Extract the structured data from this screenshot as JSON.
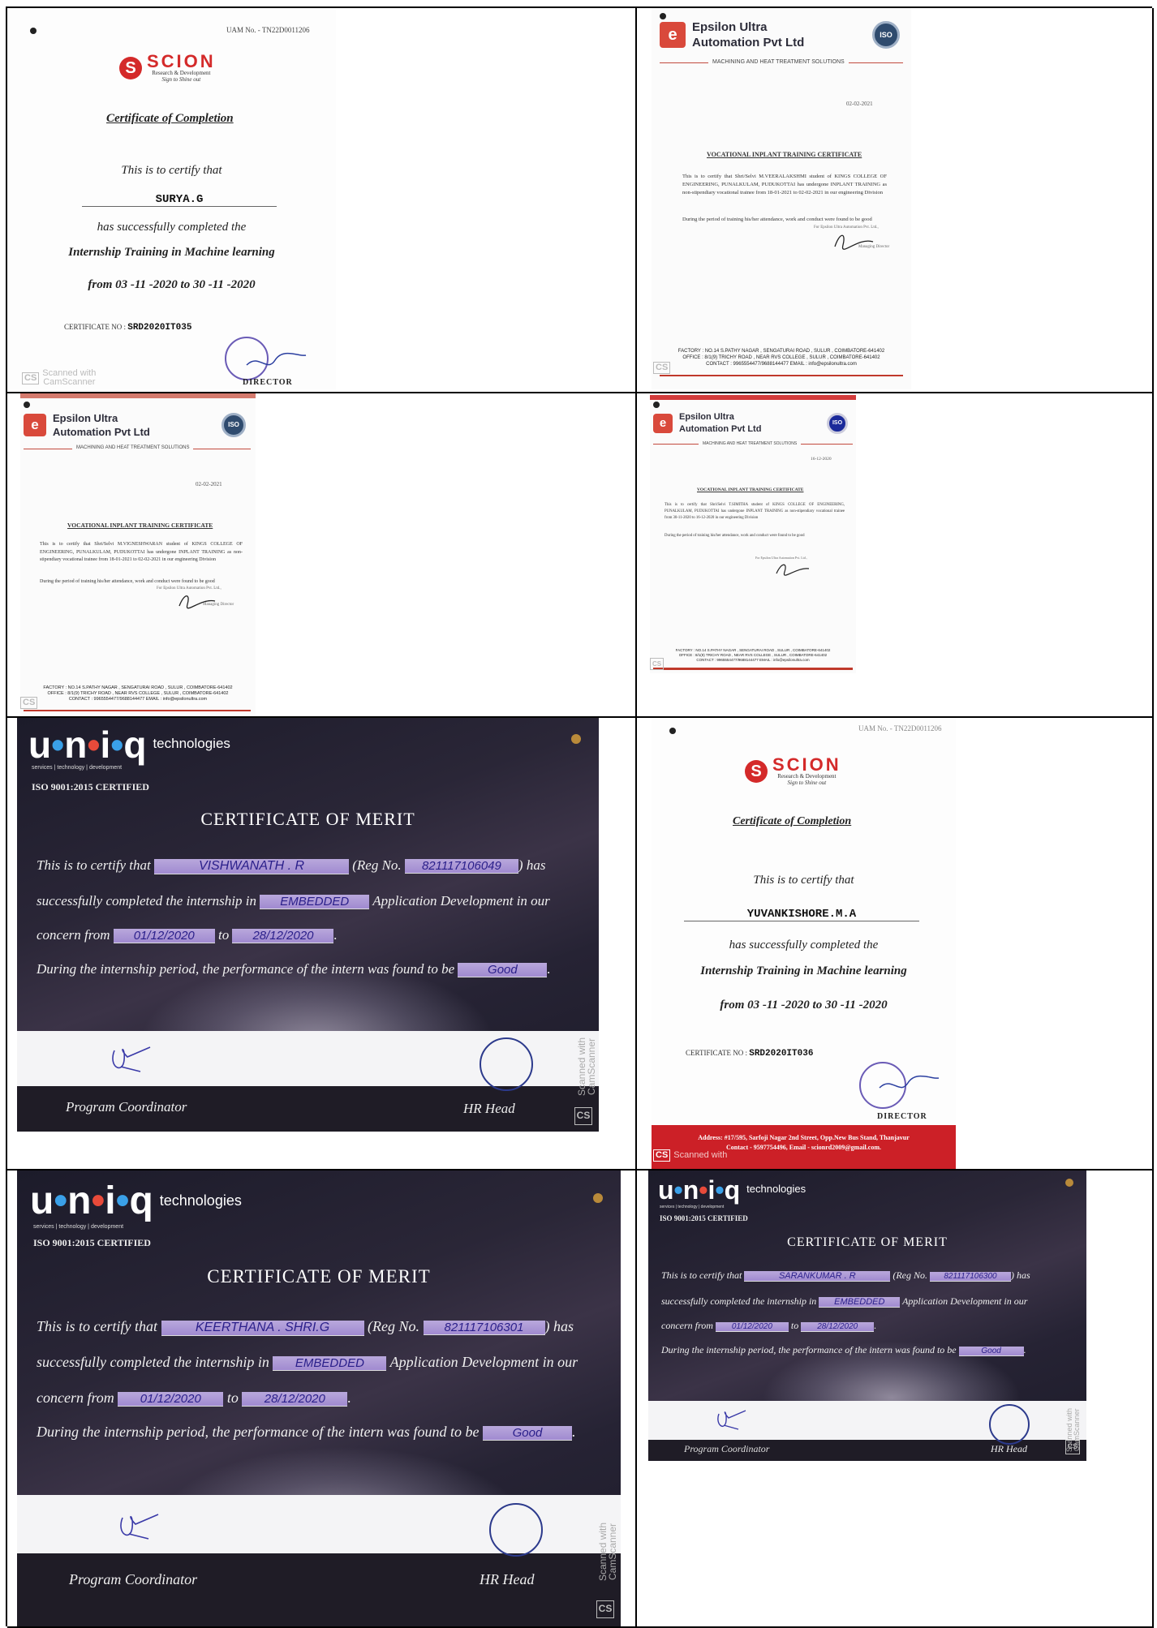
{
  "scanner": {
    "cs": "CS",
    "text1": "Scanned with",
    "text2": "CamScanner"
  },
  "scion": {
    "brand": "SCION",
    "brand_sub": "Research & Development",
    "brand_tag": "Sign to Shine out",
    "title": "Certificate of Completion",
    "certify": "This is to certify that",
    "completed": "has successfully completed the",
    "program": "Internship Training in Machine learning",
    "period": "from 03 -11 -2020 to 30 -11 -2020",
    "cert_label": "CERTIFICATE NO :",
    "director": "DIRECTOR",
    "cert1": {
      "uam": "UAM No. - TN22D0011206",
      "name": "SURYA.G",
      "cert_no": "SRD2020IT035"
    },
    "cert2": {
      "uam": "UAM No. - TN22D0011206",
      "name": "YUVANKISHORE.M.A",
      "cert_no": "SRD2020IT036",
      "footer1": "Address: #17/595, Sarfoji Nagar 2nd Street, Opp.New Bus Stand, Thanjavur",
      "footer2": "Contact - 9597754496, Email - scionrd2009@gmail.com."
    }
  },
  "epsilon": {
    "name_line1": "Epsilon Ultra",
    "name_line2": "Automation Pvt Ltd",
    "iso": "ISO",
    "tagline": "MACHINING AND HEAT TREATMENT SOLUTIONS",
    "title": "VOCATIONAL INPLANT TRAINING CERTIFICATE",
    "sign_note": "For Epsilon Ultra Automation Pvt. Ltd.,",
    "sign_role": "Managing Director",
    "conduct": "During the period of training his/her attendance, work and conduct were found to be good",
    "footer1": "FACTORY : NO.14 S.PATHY NAGAR , SENGATURAI ROAD , SULUR , COIMBATORE-641402",
    "footer2": "OFFICE : 8/1(9) TRICHY ROAD , NEAR RVS COLLEGE , SULUR , COIMBATORE-641402",
    "footer3": "CONTACT : 9965554477/9688144477   EMAIL : info@epsilonultra.com",
    "cert1": {
      "date": "02-02-2021",
      "body": "This is to certify that Shri/Selvi M.VEERALAKSHMI student of KINGS COLLEGE OF ENGINEERING, PUNALKULAM, PUDUKOTTAI has undergone INPLANT TRAINING as non-stipendiary vocational trainee from 18-01-2021 to 02-02-2021 in our engineering Division"
    },
    "cert2": {
      "date": "02-02-2021",
      "body": "This is to certify that Shri/Selvi M.VIGNESHWARAN student of KINGS COLLEGE OF ENGINEERING, PUNALKULAM, PUDUKOTTAI has undergone INPLANT TRAINING as non-stipendiary vocational trainee from 18-01-2021 to 02-02-2021 in our engineering Division"
    },
    "cert3": {
      "date": "16-12-2020",
      "body": "This is to certify that Shri/Selvi T.SIMITHA student of KINGS COLLEGE OF ENGINEERING, PUNALKULAM, PUDUKOTTAI has undergone INPLANT TRAINING as non-stipendiary vocational trainee from 30-11-2020 to 16-12-2020 in our engineering Division"
    }
  },
  "uniq": {
    "word_u": "u",
    "word_n": "n",
    "word_i": "i",
    "word_q": "q",
    "dot": "•",
    "tech": "technologies",
    "sub": "services | technology | development",
    "iso": "ISO 9001:2015 CERTIFIED",
    "title": "CERTIFICATE OF MERIT",
    "t1": "This is to certify that",
    "t_reg": "(Reg No.",
    "t_has": ") has",
    "t2": "successfully completed the internship in",
    "t2b": "Application Development in our",
    "t3": "concern from",
    "t_to": "to",
    "t_dot": ".",
    "t4": "During the internship period, the performance of the intern was found to be",
    "coordinator": "Program Coordinator",
    "hr": "HR Head",
    "domain": "EMBEDDED",
    "from": "01/12/2020",
    "to": "28/12/2020",
    "grade": "Good",
    "cert1": {
      "name": "VISHWANATH . R",
      "reg": "821117106049"
    },
    "cert2": {
      "name": "KEERTHANA . SHRI.G",
      "reg": "821117106301"
    },
    "cert3": {
      "name": "SARANKUMAR . R",
      "reg": "821117106300"
    }
  }
}
